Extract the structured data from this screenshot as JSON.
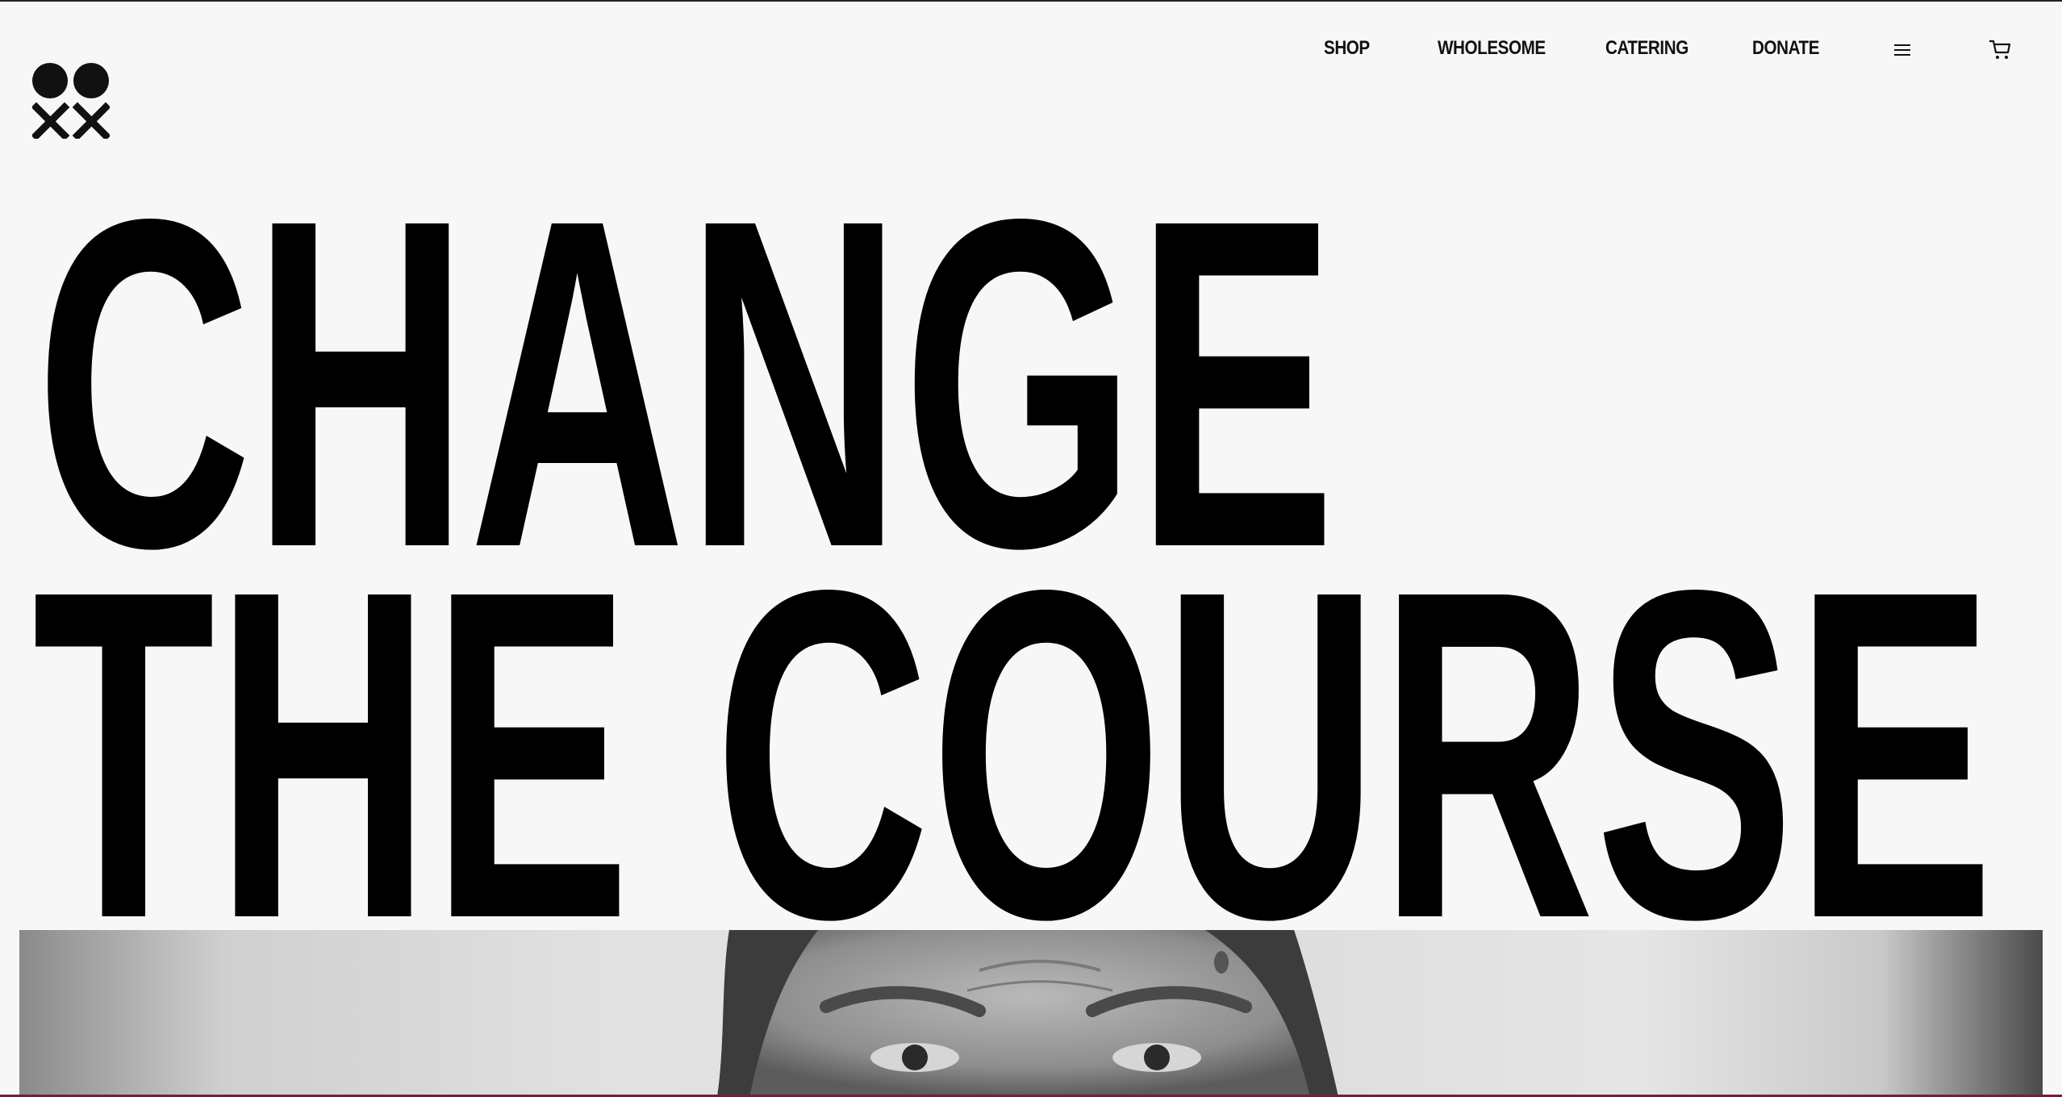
{
  "header": {
    "logo_icon": "circles-and-crosses-logo",
    "nav": [
      {
        "label": "SHOP"
      },
      {
        "label": "WHOLESOME"
      },
      {
        "label": "CATERING"
      },
      {
        "label": "DONATE"
      }
    ],
    "menu_icon": "hamburger-menu-icon",
    "cart_icon": "shopping-cart-icon"
  },
  "hero": {
    "line1": "CHANGE",
    "line2": "THE COURSE"
  },
  "photo": {
    "description_icon": "portrait-photo"
  },
  "colors": {
    "background": "#f7f7f7",
    "text": "#000000",
    "bottom_border": "#7a1a44"
  }
}
